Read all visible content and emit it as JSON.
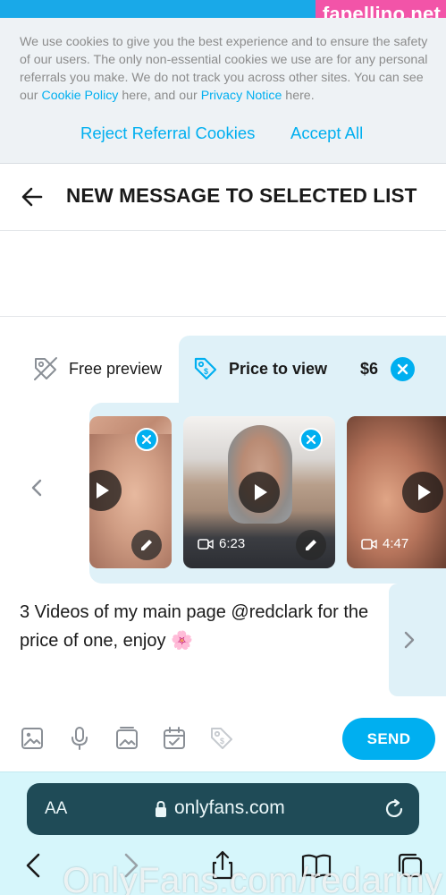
{
  "watermark": "fapellino.net",
  "cookie_banner": {
    "text_1": "We use cookies to give you the best experience and to ensure the safety of our users. The only non-essential cookies we use are for any personal referrals you make. We do not track you across other sites. You can see our ",
    "cookie_policy_link": "Cookie Policy",
    "text_2": " here, and our ",
    "privacy_notice_link": "Privacy Notice",
    "text_3": " here.",
    "reject_label": "Reject Referral Cookies",
    "accept_label": "Accept All",
    "accent_color": "#00aff0"
  },
  "header": {
    "title": "NEW MESSAGE TO SELECTED LIST",
    "back_icon": "arrow-left-icon"
  },
  "tabs": {
    "free_label": "Free preview",
    "price_label": "Price to view",
    "price_amount": "$6"
  },
  "media": [
    {
      "name": "video-1",
      "duration": ""
    },
    {
      "name": "video-2",
      "duration": "6:23"
    },
    {
      "name": "video-3",
      "duration": "4:47"
    }
  ],
  "message": {
    "text": "3 Videos of my main page @redclark for the price of one, enjoy 🌸"
  },
  "toolbar": {
    "icons": [
      "image-icon",
      "microphone-icon",
      "gallery-icon",
      "calendar-icon",
      "price-tag-icon"
    ],
    "send_label": "SEND"
  },
  "browser": {
    "aa_label": "AA",
    "url": "onlyfans.com",
    "nav_icons": [
      "back-icon",
      "forward-icon",
      "share-icon",
      "bookmarks-icon",
      "tabs-icon"
    ]
  },
  "bottom_watermark": "OnlyFans.com/redarmy"
}
